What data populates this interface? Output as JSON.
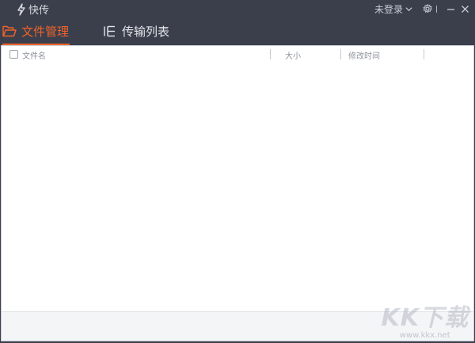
{
  "app": {
    "title": "快传"
  },
  "window_controls": {
    "login_label": "未登录"
  },
  "tabs": [
    {
      "label": "文件管理",
      "active": true
    },
    {
      "label": "传输列表",
      "active": false
    }
  ],
  "table": {
    "columns": {
      "name": "文件名",
      "size": "大小",
      "modified": "修改时间"
    },
    "rows": []
  },
  "watermark": {
    "logo_text": "KK下载",
    "url": "www.kkx.net"
  },
  "colors": {
    "accent": "#f0642a",
    "titlebar_bg": "#3b3f4c"
  },
  "icons": [
    "bolt-icon",
    "chevron-down-icon",
    "gear-icon",
    "minimize-icon",
    "close-icon",
    "folder-icon",
    "list-icon"
  ]
}
